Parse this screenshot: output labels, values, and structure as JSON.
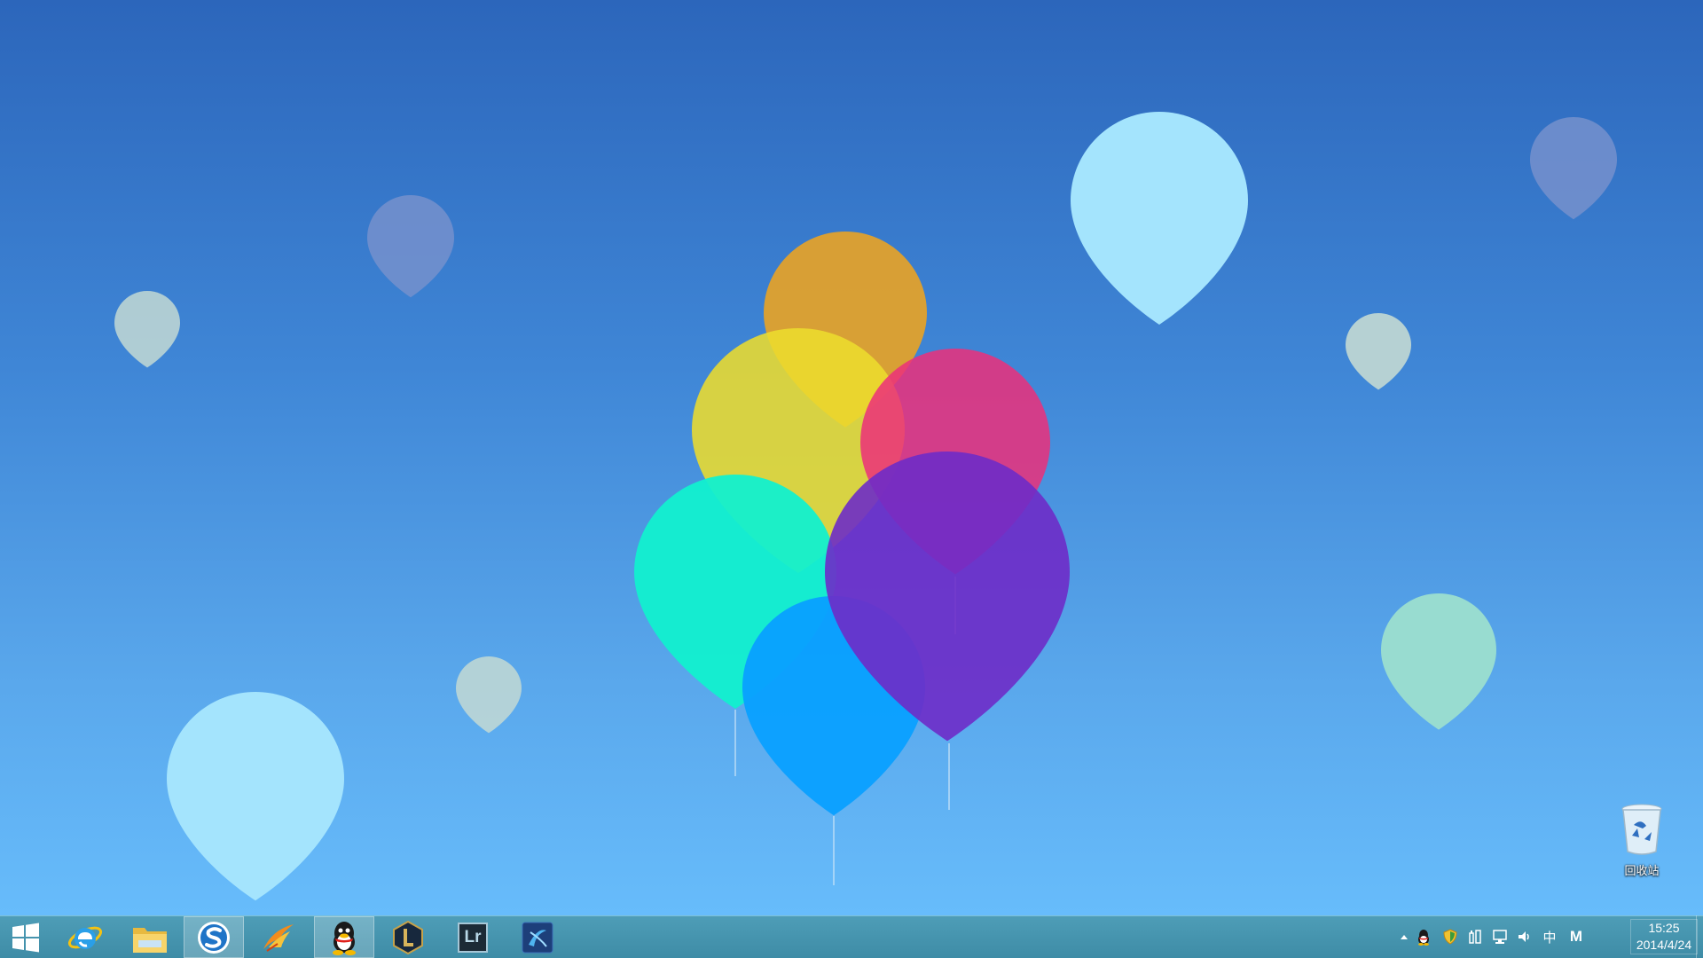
{
  "desktop": {
    "icons": [
      {
        "name": "recycle-bin",
        "label": "回收站"
      }
    ]
  },
  "taskbar": {
    "pinned": [
      {
        "name": "internet-explorer",
        "icon": "ie-icon",
        "active": false
      },
      {
        "name": "file-explorer",
        "icon": "folder-icon",
        "active": false
      },
      {
        "name": "sogou-browser",
        "icon": "sogou-icon",
        "active": true
      },
      {
        "name": "swift-app",
        "icon": "swift-bird-icon",
        "active": false
      },
      {
        "name": "qq",
        "icon": "qq-penguin-icon",
        "active": true
      },
      {
        "name": "league-of-legends",
        "icon": "lol-icon",
        "active": false
      },
      {
        "name": "lightroom",
        "icon": "lr-icon",
        "label": "Lr",
        "active": false
      },
      {
        "name": "app-blue-logo",
        "icon": "blue-swirl-icon",
        "active": false
      }
    ],
    "tray": {
      "ime_label": "中",
      "m_label": "M",
      "time": "15:25",
      "date": "2014/4/24"
    }
  },
  "colors": {
    "accent": "#3e8ca6",
    "balloon_orange": "#e0a12c",
    "balloon_yellow": "#e6d532",
    "balloon_pink": "#e23a80",
    "balloon_cyan": "#14ebd0",
    "balloon_blue": "#12a1ff",
    "balloon_purple": "#7030c8"
  }
}
